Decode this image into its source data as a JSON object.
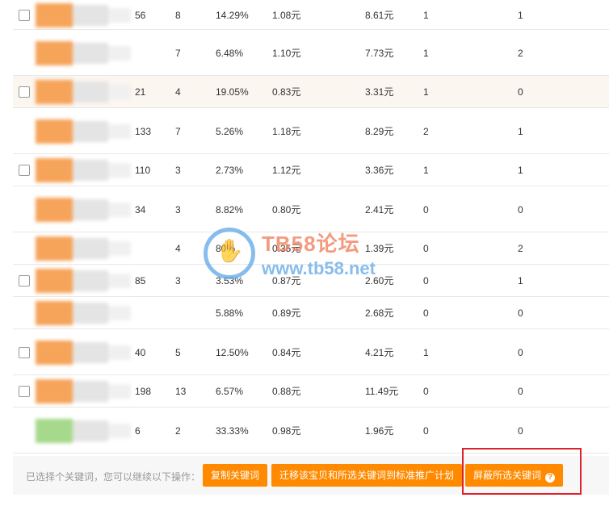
{
  "table": {
    "rows": [
      {
        "c1": "56",
        "c2": "8",
        "rate": "14.29%",
        "cpc": "1.08元",
        "cost": "8.61元",
        "c5": "1",
        "c6": "1",
        "checkbox": true,
        "highlight": false,
        "thumb": "orange"
      },
      {
        "c1": "",
        "c2": "7",
        "rate": "6.48%",
        "cpc": "1.10元",
        "cost": "7.73元",
        "c5": "1",
        "c6": "2",
        "checkbox": false,
        "highlight": false,
        "thumb": "orange"
      },
      {
        "c1": "21",
        "c2": "4",
        "rate": "19.05%",
        "cpc": "0.83元",
        "cost": "3.31元",
        "c5": "1",
        "c6": "0",
        "checkbox": true,
        "highlight": true,
        "thumb": "orange"
      },
      {
        "c1": "133",
        "c2": "7",
        "rate": "5.26%",
        "cpc": "1.18元",
        "cost": "8.29元",
        "c5": "2",
        "c6": "1",
        "checkbox": false,
        "highlight": false,
        "thumb": "orange"
      },
      {
        "c1": "110",
        "c2": "3",
        "rate": "2.73%",
        "cpc": "1.12元",
        "cost": "3.36元",
        "c5": "1",
        "c6": "1",
        "checkbox": true,
        "highlight": false,
        "thumb": "orange"
      },
      {
        "c1": "34",
        "c2": "3",
        "rate": "8.82%",
        "cpc": "0.80元",
        "cost": "2.41元",
        "c5": "0",
        "c6": "0",
        "checkbox": false,
        "highlight": false,
        "thumb": "orange"
      },
      {
        "c1": "",
        "c2": "4",
        "rate": "80%",
        "cpc": "0.35元",
        "cost": "1.39元",
        "c5": "0",
        "c6": "2",
        "checkbox": false,
        "highlight": false,
        "thumb": "orange"
      },
      {
        "c1": "85",
        "c2": "3",
        "rate": "3.53%",
        "cpc": "0.87元",
        "cost": "2.60元",
        "c5": "0",
        "c6": "1",
        "checkbox": true,
        "highlight": false,
        "thumb": "orange"
      },
      {
        "c1": "",
        "c2": "",
        "rate": "5.88%",
        "cpc": "0.89元",
        "cost": "2.68元",
        "c5": "0",
        "c6": "0",
        "checkbox": false,
        "highlight": false,
        "thumb": "orange"
      },
      {
        "c1": "40",
        "c2": "5",
        "rate": "12.50%",
        "cpc": "0.84元",
        "cost": "4.21元",
        "c5": "1",
        "c6": "0",
        "checkbox": true,
        "highlight": false,
        "thumb": "orange"
      },
      {
        "c1": "198",
        "c2": "13",
        "rate": "6.57%",
        "cpc": "0.88元",
        "cost": "11.49元",
        "c5": "0",
        "c6": "0",
        "checkbox": true,
        "highlight": false,
        "thumb": "orange"
      },
      {
        "c1": "6",
        "c2": "2",
        "rate": "33.33%",
        "cpc": "0.98元",
        "cost": "1.96元",
        "c5": "0",
        "c6": "0",
        "checkbox": false,
        "highlight": false,
        "thumb": "green"
      }
    ]
  },
  "footer": {
    "label": "已选择个关键词，您可以继续以下操作：",
    "copy_button": "复制关键词",
    "migrate_button": "迁移该宝贝和所选关键词到标准推广计划",
    "block_button": "屏蔽所选关键词",
    "help_icon": "?"
  },
  "watermark": {
    "title": "TB58论坛",
    "url": "www.tb58.net"
  },
  "colors": {
    "accent": "#ff8a00",
    "highlight_box": "#e0212b",
    "row_highlight": "#fbf6f0"
  }
}
